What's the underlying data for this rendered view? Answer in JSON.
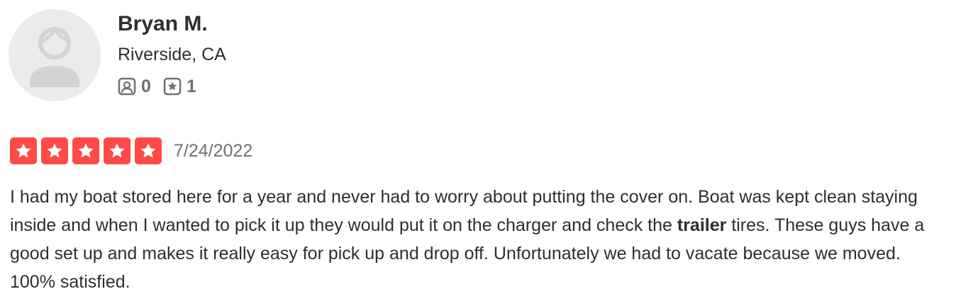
{
  "user": {
    "name": "Bryan M.",
    "location": "Riverside, CA",
    "friends_count": "0",
    "reviews_count": "1"
  },
  "review": {
    "rating": 5,
    "max_rating": 5,
    "date": "7/24/2022",
    "text_part1": "I had my boat stored here for a year and never had to worry about putting the cover on. Boat was kept clean staying inside and when I wanted to pick it up they would put it on the charger and check the ",
    "text_bold": "trailer",
    "text_part2": " tires. These guys have a good set up and makes it really easy for pick up and drop off. Unfortunately we had to vacate because we moved. 100% satisfied."
  },
  "icons": {
    "avatar": "default-user-avatar-icon",
    "friends": "friends-icon",
    "reviews": "review-star-icon",
    "rating_star": "star-icon"
  },
  "colors": {
    "star_fill": "#ff4a46",
    "text": "#2d2e2f",
    "muted": "#6e7072",
    "avatar_bg": "#ebebeb"
  }
}
